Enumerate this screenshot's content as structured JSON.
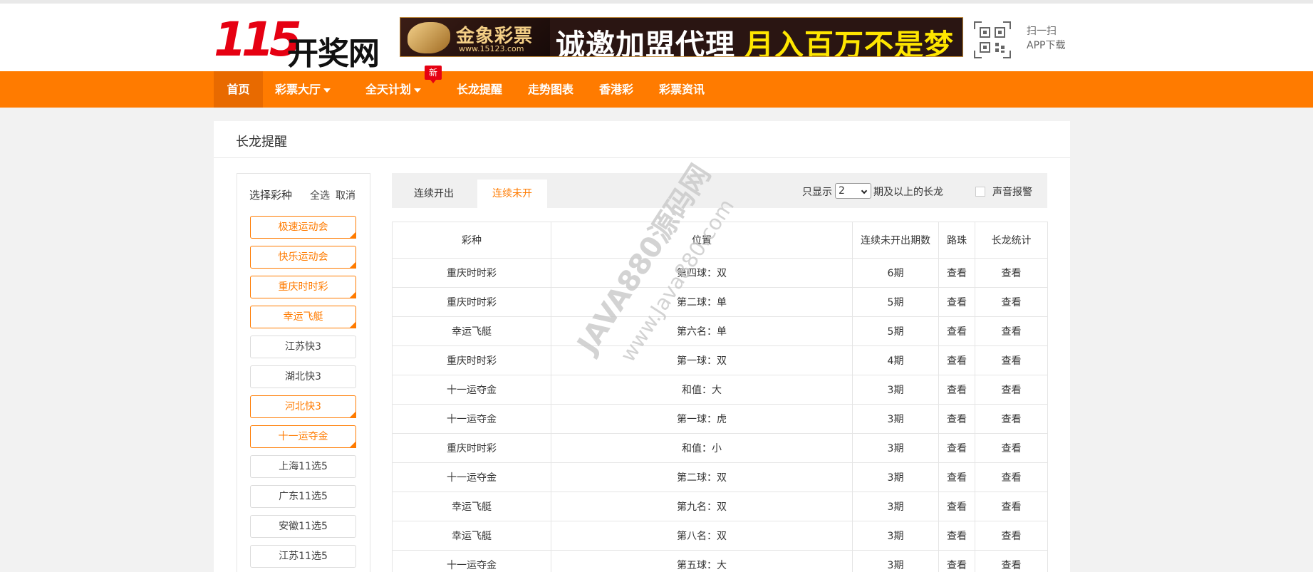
{
  "header": {
    "logo_number": "115",
    "logo_text": "开奖网",
    "banner": {
      "brand_name": "金象彩票",
      "brand_url": "www.15123.com",
      "slogan_white": "诚邀加盟代理",
      "slogan_yellow": "月入百万不是梦"
    },
    "qr": {
      "line1": "扫一扫",
      "line2": "APP下载"
    }
  },
  "nav": {
    "items": [
      {
        "label": "首页"
      },
      {
        "label": "彩票大厅"
      },
      {
        "label": "全天计划"
      },
      {
        "label": "长龙提醒"
      },
      {
        "label": "走势图表"
      },
      {
        "label": "香港彩"
      },
      {
        "label": "彩票资讯"
      }
    ],
    "new_badge": "新"
  },
  "page": {
    "title": "长龙提醒"
  },
  "sidebar": {
    "heading": "选择彩种",
    "select_all": "全选",
    "cancel": "取消",
    "lotteries": [
      {
        "label": "极速运动会",
        "selected": true
      },
      {
        "label": "快乐运动会",
        "selected": true
      },
      {
        "label": "重庆时时彩",
        "selected": true
      },
      {
        "label": "幸运飞艇",
        "selected": true
      },
      {
        "label": "江苏快3",
        "selected": false
      },
      {
        "label": "湖北快3",
        "selected": false
      },
      {
        "label": "河北快3",
        "selected": true
      },
      {
        "label": "十一运夺金",
        "selected": true
      },
      {
        "label": "上海11选5",
        "selected": false
      },
      {
        "label": "广东11选5",
        "selected": false
      },
      {
        "label": "安徽11选5",
        "selected": false
      },
      {
        "label": "江苏11选5",
        "selected": false
      }
    ]
  },
  "tabs": [
    {
      "label": "连续开出",
      "active": false
    },
    {
      "label": "连续未开",
      "active": true
    }
  ],
  "filter": {
    "prefix": "只显示",
    "value": "2",
    "suffix": "期及以上的长龙",
    "sound_label": "声音报警",
    "sound_checked": false
  },
  "table": {
    "headers": [
      "彩种",
      "位置",
      "连续未开出期数",
      "路珠",
      "长龙统计"
    ],
    "rows": [
      {
        "lottery": "重庆时时彩",
        "position": "第四球：双",
        "periods": "6期",
        "road": "查看",
        "stats": "查看"
      },
      {
        "lottery": "重庆时时彩",
        "position": "第二球：单",
        "periods": "5期",
        "road": "查看",
        "stats": "查看"
      },
      {
        "lottery": "幸运飞艇",
        "position": "第六名：单",
        "periods": "5期",
        "road": "查看",
        "stats": "查看"
      },
      {
        "lottery": "重庆时时彩",
        "position": "第一球：双",
        "periods": "4期",
        "road": "查看",
        "stats": "查看"
      },
      {
        "lottery": "十一运夺金",
        "position": "和值：大",
        "periods": "3期",
        "road": "查看",
        "stats": "查看"
      },
      {
        "lottery": "十一运夺金",
        "position": "第一球：虎",
        "periods": "3期",
        "road": "查看",
        "stats": "查看"
      },
      {
        "lottery": "重庆时时彩",
        "position": "和值：小",
        "periods": "3期",
        "road": "查看",
        "stats": "查看"
      },
      {
        "lottery": "十一运夺金",
        "position": "第二球：双",
        "periods": "3期",
        "road": "查看",
        "stats": "查看"
      },
      {
        "lottery": "幸运飞艇",
        "position": "第九名：双",
        "periods": "3期",
        "road": "查看",
        "stats": "查看"
      },
      {
        "lottery": "幸运飞艇",
        "position": "第八名：双",
        "periods": "3期",
        "road": "查看",
        "stats": "查看"
      },
      {
        "lottery": "十一运夺金",
        "position": "第五球：大",
        "periods": "3期",
        "road": "查看",
        "stats": "查看"
      }
    ]
  },
  "watermark": {
    "line1": "JAVA880源码网",
    "line2": "www.Java880.com"
  },
  "colors": {
    "accent": "#ff7b00",
    "nav_active": "#e86a00",
    "badge": "#e60012"
  }
}
